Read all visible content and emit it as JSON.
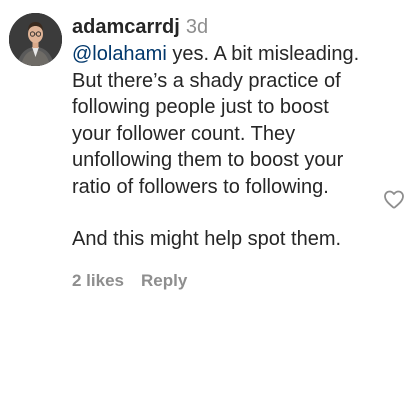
{
  "comment": {
    "username": "adamcarrdj",
    "time_ago": "3d",
    "mention": "@lolahami",
    "paragraph1_text": " yes. A bit misleading. But there’s a shady practice of following people just to boost your follower count. They unfollowing them to boost your ratio of followers to following.",
    "paragraph2_text": "And this might help spot them.",
    "likes_label": "2 likes",
    "reply_label": "Reply"
  },
  "icons": {
    "like": "heart-outline-icon",
    "avatar": "profile-avatar"
  },
  "colors": {
    "text": "#262626",
    "muted": "#8e8e8e",
    "mention": "#00376b"
  }
}
